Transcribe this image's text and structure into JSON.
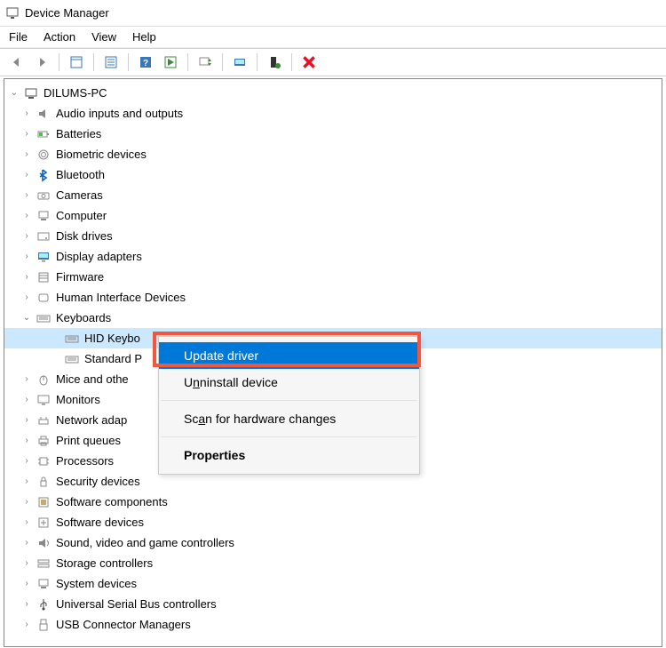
{
  "title": "Device Manager",
  "menubar": {
    "file": "File",
    "action": "Action",
    "view": "View",
    "help": "Help"
  },
  "root": "DILUMS-PC",
  "categories": [
    "Audio inputs and outputs",
    "Batteries",
    "Biometric devices",
    "Bluetooth",
    "Cameras",
    "Computer",
    "Disk drives",
    "Display adapters",
    "Firmware",
    "Human Interface Devices",
    "Keyboards",
    "Mice and othe",
    "Monitors",
    "Network adap",
    "Print queues",
    "Processors",
    "Security devices",
    "Software components",
    "Software devices",
    "Sound, video and game controllers",
    "Storage controllers",
    "System devices",
    "Universal Serial Bus controllers",
    "USB Connector Managers"
  ],
  "keyboards": {
    "child1": "HID Keybo",
    "child2": "Standard P"
  },
  "context_menu": {
    "update": "Update driver",
    "uninstall_prefix": "U",
    "uninstall_suffix": "ninstall device",
    "scan_prefix": "Sc",
    "scan_suffix": "n for hardware changes",
    "properties": "Properties"
  }
}
